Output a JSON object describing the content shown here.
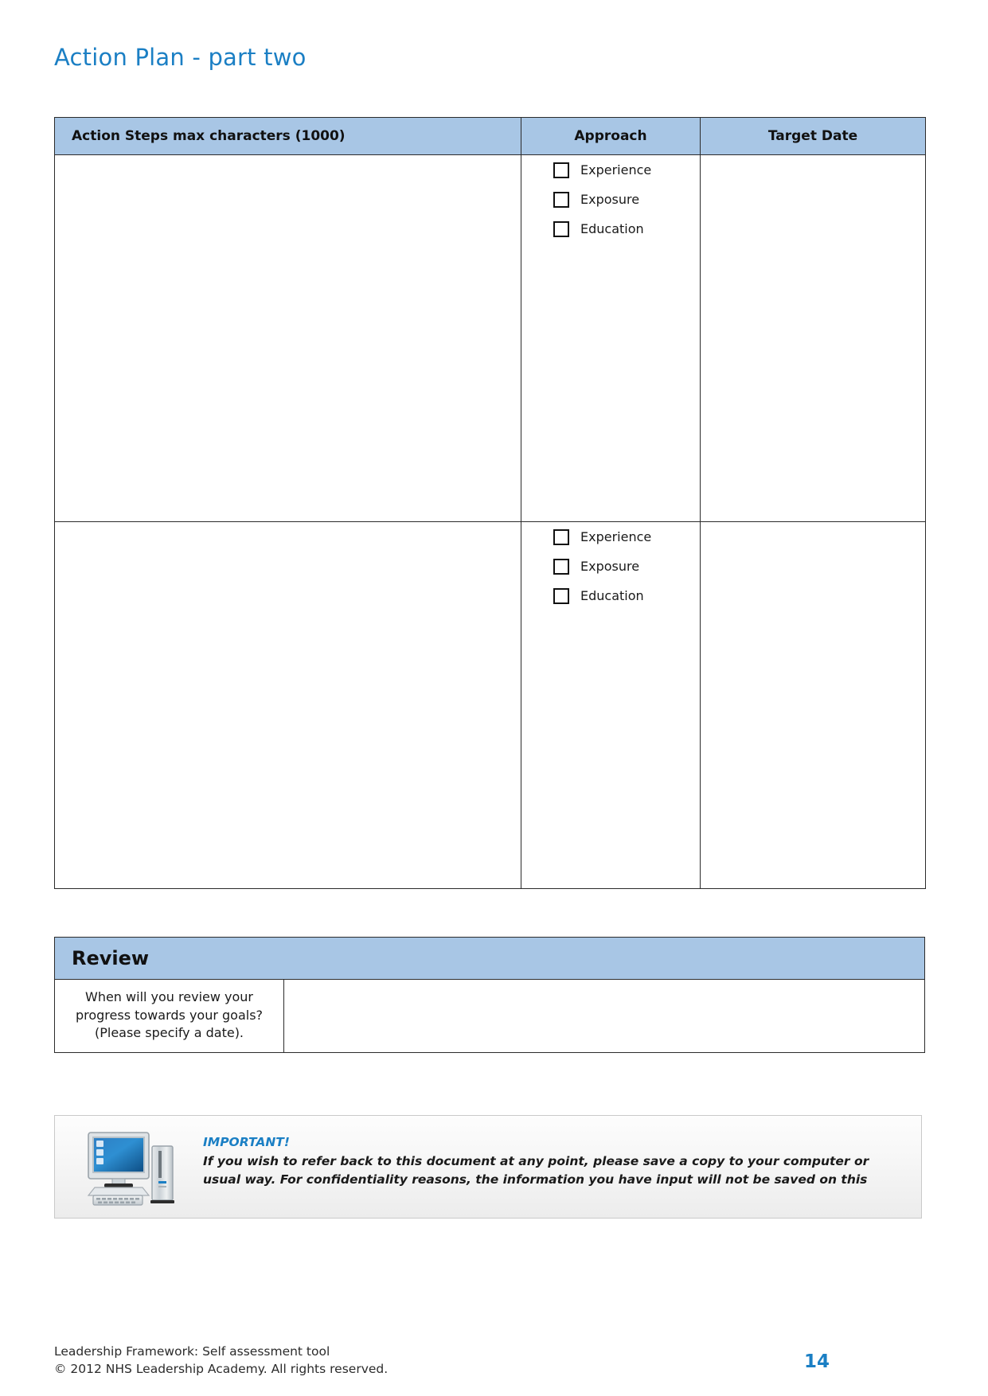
{
  "document": {
    "title": "Action Plan - part two"
  },
  "action_table": {
    "headers": {
      "steps": "Action Steps max characters (1000)",
      "approach": "Approach",
      "target_date": "Target Date"
    },
    "rows": [
      {
        "steps_value": "",
        "approach_options": [
          "Experience",
          "Exposure",
          "Education"
        ],
        "target_date_value": ""
      },
      {
        "steps_value": "",
        "approach_options": [
          "Experience",
          "Exposure",
          "Education"
        ],
        "target_date_value": ""
      }
    ]
  },
  "review": {
    "heading": "Review",
    "question_line1": "When will you review your",
    "question_line2": "progress towards your goals?",
    "question_line3": "(Please specify a date).",
    "answer_value": ""
  },
  "notice": {
    "icon": "desktop-computer-icon",
    "title": "IMPORTANT!",
    "line1": "If you wish to refer back to this document at any point, please save a copy to your computer or",
    "line2": "usual way. For confidentiality reasons, the information you have input will not be saved on this"
  },
  "footer": {
    "line1": "Leadership Framework: Self assessment tool",
    "line2": "© 2012 NHS Leadership Academy.  All rights reserved.",
    "page_number": "14"
  },
  "colors": {
    "accent_blue": "#1b7fc4",
    "header_band": "#a8c6e5",
    "border": "#2b2b2b"
  }
}
